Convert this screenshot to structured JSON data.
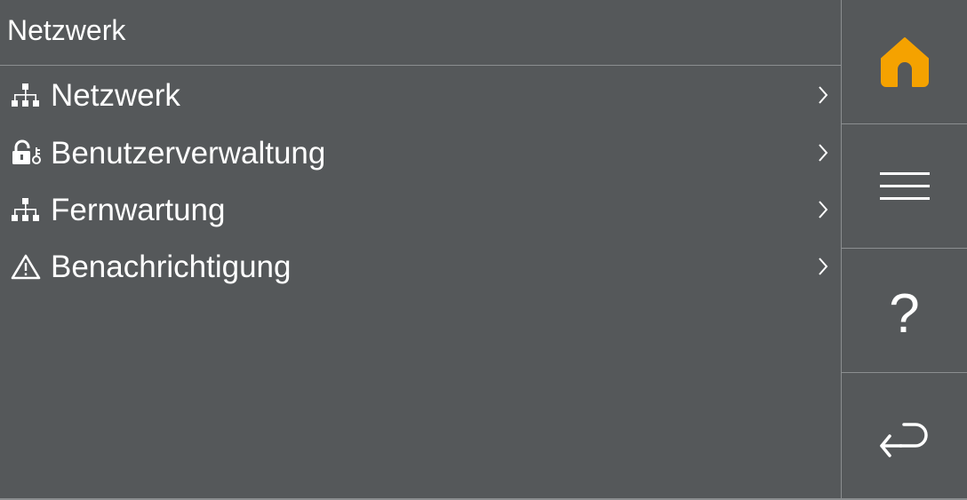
{
  "header": {
    "title": "Netzwerk"
  },
  "menu": {
    "items": [
      {
        "label": "Netzwerk",
        "icon": "network-icon"
      },
      {
        "label": "Benutzerverwaltung",
        "icon": "lock-key-icon"
      },
      {
        "label": "Fernwartung",
        "icon": "network-icon"
      },
      {
        "label": "Benachrichtigung",
        "icon": "warning-icon"
      }
    ]
  },
  "sidebar": {
    "home_icon": "home-icon",
    "menu_icon": "hamburger-menu-icon",
    "help_label": "?",
    "back_icon": "return-icon"
  },
  "colors": {
    "background": "#55585a",
    "divider": "#8b8e90",
    "text": "#ffffff",
    "accent": "#f5a200"
  }
}
